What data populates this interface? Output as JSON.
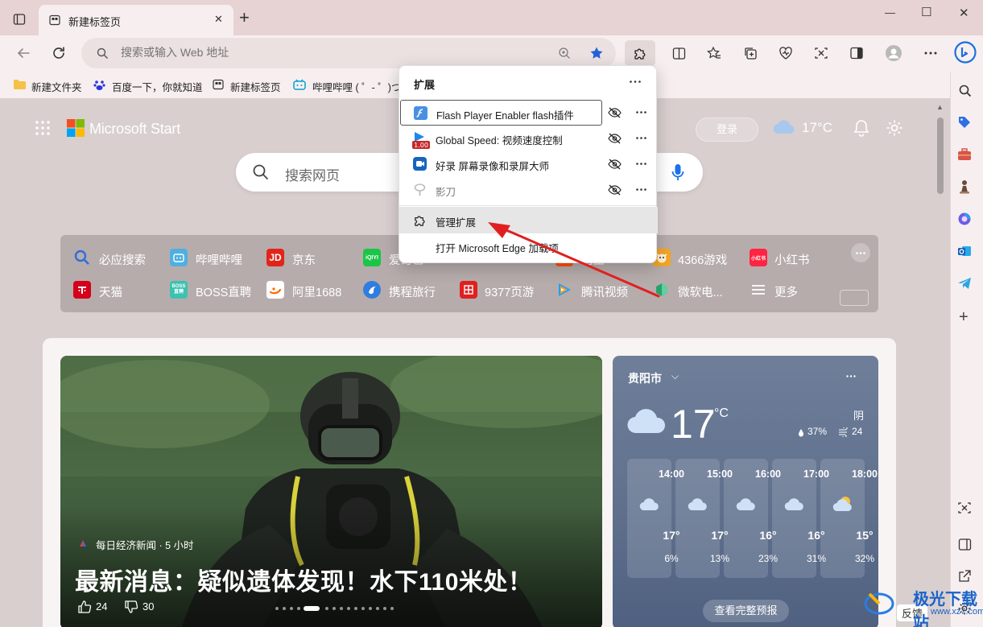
{
  "tab": {
    "title": "新建标签页",
    "close": "✕",
    "new": "+"
  },
  "window": {
    "minimize": "—",
    "maximize": "☐",
    "close": "✕"
  },
  "address": {
    "placeholder": "搜索或输入 Web 地址"
  },
  "favorites": [
    {
      "label": "新建文件夹",
      "icon": "folder-icon"
    },
    {
      "label": "百度一下，你就知道",
      "icon": "baidu-icon"
    },
    {
      "label": "新建标签页",
      "icon": "newtab-icon"
    },
    {
      "label": "哔哩哔哩 ( ゜- ゜)つ...",
      "icon": "bilibili-icon"
    }
  ],
  "extensions_popup": {
    "title": "扩展",
    "items": [
      {
        "name": "Flash Player Enabler flash插件",
        "icon": "flash-icon",
        "color": "#4a90e2"
      },
      {
        "name": "Global Speed: 视频速度控制",
        "icon": "speed-icon",
        "color": "#1e88e5"
      },
      {
        "name": "好录 屏幕录像和录屏大师",
        "icon": "recorder-icon",
        "color": "#1565c0"
      },
      {
        "name": "影刀",
        "icon": "yingdao-icon",
        "color": "#bdbdbd"
      }
    ],
    "manage": "管理扩展",
    "open_addons": "打开 Microsoft Edge 加载项"
  },
  "newtab": {
    "brand": "Microsoft Start",
    "search_placeholder": "搜索网页",
    "login": "登录",
    "temp": "17°C"
  },
  "quicklinks": [
    {
      "label": "必应搜索",
      "color": "#2e6fd8"
    },
    {
      "label": "哔哩哔哩",
      "color": "#4fb0e0"
    },
    {
      "label": "京东",
      "color": "#e1251b"
    },
    {
      "label": "爱奇艺",
      "color": "#1ac646"
    },
    {
      "label": "淘宝",
      "color": "#ff5000"
    },
    {
      "label": "4366游戏",
      "color": "#f5a623"
    },
    {
      "label": "小红书",
      "color": "#ff2442"
    },
    {
      "label": "天猫",
      "color": "#d4001a"
    },
    {
      "label": "BOSS直聘",
      "color": "#3cc2b0"
    },
    {
      "label": "阿里1688",
      "color": "#ff6a00"
    },
    {
      "label": "携程旅行",
      "color": "#2f7de1"
    },
    {
      "label": "9377页游",
      "color": "#e02020"
    },
    {
      "label": "腾讯视频",
      "color": "#20a0ff"
    },
    {
      "label": "微软电...",
      "color": "#2aa06a"
    },
    {
      "label": "更多",
      "color": "#ffffff"
    }
  ],
  "hero": {
    "source": "每日经济新闻 · 5 小时",
    "title": "最新消息：疑似遗体发现！水下110米处！",
    "likes": "24",
    "dislikes": "30"
  },
  "weather": {
    "city": "贵阳市",
    "temp": "17",
    "unit": "°C",
    "condition": "阴",
    "humidity": "37%",
    "wind": "24",
    "hours": [
      {
        "time": "14:00",
        "temp": "17°",
        "precip": "6%"
      },
      {
        "time": "15:00",
        "temp": "17°",
        "precip": "13%"
      },
      {
        "time": "16:00",
        "temp": "16°",
        "precip": "23%"
      },
      {
        "time": "17:00",
        "temp": "16°",
        "precip": "31%"
      },
      {
        "time": "18:00",
        "temp": "15°",
        "precip": "32%"
      }
    ],
    "full_forecast": "查看完整预报"
  },
  "feedback": "反馈",
  "watermark": {
    "title": "极光下载站",
    "url": "www.xz7.com"
  }
}
